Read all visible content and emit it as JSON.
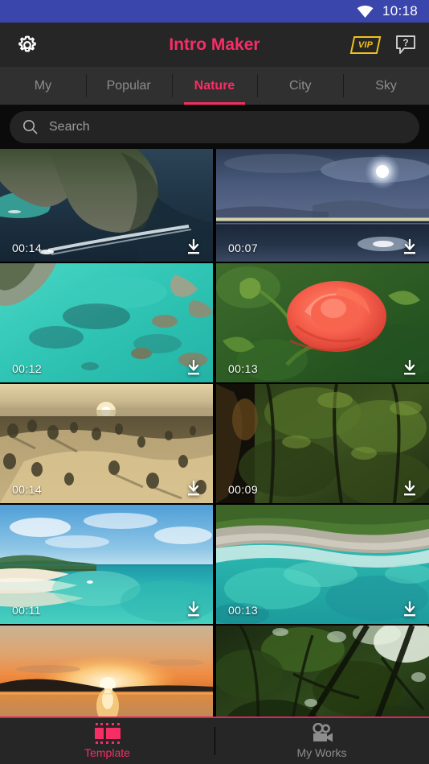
{
  "status_bar": {
    "time": "10:18",
    "wifi_icon": "wifi-icon",
    "background": "#3b46ad"
  },
  "app_bar": {
    "title": "Intro Maker",
    "title_color": "#f72d66",
    "settings_icon": "gear-icon",
    "vip_label": "VIP",
    "vip_color": "#f2c218",
    "help_icon": "help-icon"
  },
  "tabs": {
    "active_index": 2,
    "active_color": "#f72d66",
    "items": [
      {
        "label": "My"
      },
      {
        "label": "Popular"
      },
      {
        "label": "Nature"
      },
      {
        "label": "City"
      },
      {
        "label": "Sky"
      }
    ]
  },
  "search": {
    "placeholder": "Search",
    "value": "",
    "icon": "search-icon"
  },
  "grid": {
    "download_icon": "download-icon",
    "items": [
      {
        "duration": "00:14",
        "scene": "aerial-limestone-island-boat"
      },
      {
        "duration": "00:07",
        "scene": "moonlit-bay-city-lights"
      },
      {
        "duration": "00:12",
        "scene": "turquoise-rocky-shore-aerial"
      },
      {
        "duration": "00:13",
        "scene": "red-rose-closeup"
      },
      {
        "duration": "00:14",
        "scene": "snowy-desert-dunes-sunset"
      },
      {
        "duration": "00:09",
        "scene": "dark-forest-canopy"
      },
      {
        "duration": "00:11",
        "scene": "white-sand-beach-lagoon"
      },
      {
        "duration": "00:13",
        "scene": "rocky-coast-turquoise-water"
      },
      {
        "duration": "",
        "scene": "lake-sunset-silhouette"
      },
      {
        "duration": "",
        "scene": "forest-trees-looking-up"
      }
    ]
  },
  "bottom_nav": {
    "accent": "#e61e63",
    "items": [
      {
        "label": "Template",
        "icon": "film-strip-icon",
        "active": true
      },
      {
        "label": "My Works",
        "icon": "video-camera-icon",
        "active": false
      }
    ]
  }
}
